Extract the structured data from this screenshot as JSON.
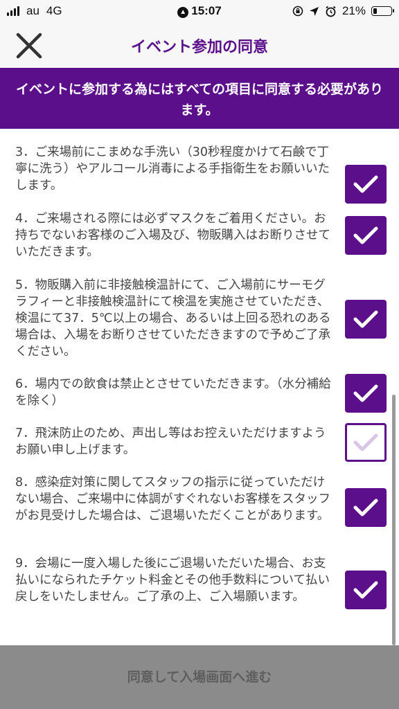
{
  "status_bar": {
    "carrier": "au",
    "network": "4G",
    "time": "15:07",
    "battery": "21%",
    "battery_level": 0.21
  },
  "header": {
    "title": "イベント参加の同意"
  },
  "banner": {
    "text": "イベントに参加する為にはすべての項目に同意する必要があります。"
  },
  "items": [
    {
      "text": "3．ご来場前にこまめな手洗い（30秒程度かけて石鹸で丁寧に洗う）やアルコール消毒による手指衛生をお願いいたします。",
      "checked": true
    },
    {
      "text": "4．ご来場される際には必ずマスクをご着用ください。お持ちでないお客様のご入場及び、物販購入はお断りさせていただきます。",
      "checked": true
    },
    {
      "text": "5．物販購入前に非接触検温計にて、ご入場前にサーモグラフィーと非接触検温計にて検温を実施させていただき、検温にて37．5℃以上の場合、あるいは上回る恐れのある場合は、入場をお断りさせていただきますので予めご了承ください。",
      "checked": true
    },
    {
      "text": "6．場内での飲食は禁止とさせていただきます。（水分補給を除く）",
      "checked": true
    },
    {
      "text": "7．飛沫防止のため、声出し等はお控えいただけますようお願い申し上げます。",
      "checked": false
    },
    {
      "text": "8．感染症対策に関してスタッフの指示に従っていただけない場合、ご来場中に体調がすぐれないお客様をスタッフがお見受けした場合は、ご退場いただくことがあります。",
      "checked": true
    },
    {
      "text": "9．会場に一度入場した後にご退場いただいた場合、お支払いになられたチケット料金とその他手数料について払い戻しをいたしません。ご了承の上、ご入場願います。",
      "checked": true
    }
  ],
  "footer": {
    "button_label": "同意して入場画面へ進む"
  },
  "colors": {
    "accent": "#5c0f8b",
    "footer_bg": "#8b8b8b"
  },
  "icons": {
    "close": "close-icon",
    "check": "checkmark-icon"
  }
}
